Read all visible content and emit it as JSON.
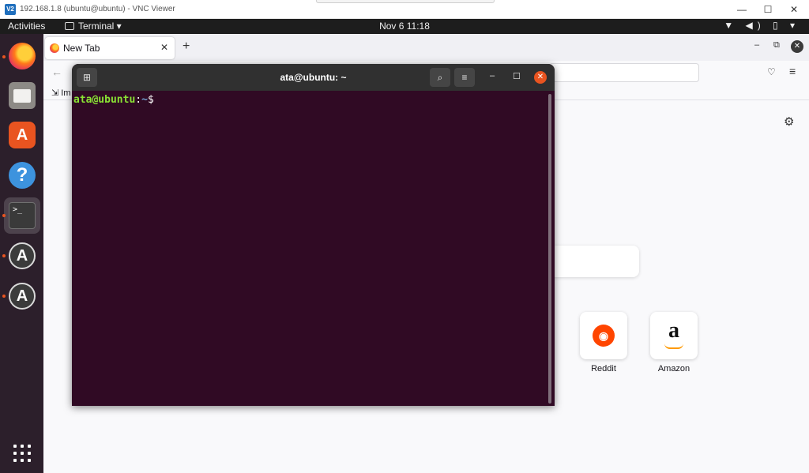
{
  "vnc": {
    "logo": "V2",
    "title": "192.168.1.8 (ubuntu@ubuntu) - VNC Viewer",
    "minimize": "—",
    "maximize": "☐",
    "close": "✕"
  },
  "topbar": {
    "activities": "Activities",
    "app_menu": "Terminal ▾",
    "clock": "Nov 6  11:18",
    "status_icons": "▼ ◀) ▯ ▾"
  },
  "dock": {
    "items": [
      {
        "name": "Firefox",
        "icon": "firefox-icon",
        "running": true
      },
      {
        "name": "Files",
        "icon": "files-icon",
        "running": false
      },
      {
        "name": "Ubuntu Software",
        "icon": "store-icon",
        "glyph": "A",
        "running": false
      },
      {
        "name": "Help",
        "icon": "help-icon",
        "glyph": "?",
        "running": false
      },
      {
        "name": "Terminal",
        "icon": "terminal-icon",
        "glyph": ">_",
        "running": true
      },
      {
        "name": "Software Updater",
        "icon": "updater-icon",
        "glyph": "A",
        "running": true
      },
      {
        "name": "Software Updater",
        "icon": "updater-icon",
        "glyph": "A",
        "running": true
      }
    ]
  },
  "firefox": {
    "tab_label": "New Tab",
    "tab_close": "✕",
    "new_tab": "+",
    "win_minimize": "–",
    "win_restore": "⧉",
    "win_close": "✕",
    "back": "←",
    "pocket": "♡",
    "menu": "≡",
    "bookmark_item": "⇲ Im",
    "settings": "⚙",
    "shortcuts": [
      {
        "label": "Reddit",
        "glyph": "◉"
      },
      {
        "label": "Amazon",
        "glyph": "a"
      }
    ]
  },
  "terminal": {
    "title": "ata@ubuntu: ~",
    "new_tab_glyph": "⊞",
    "search_glyph": "⌕",
    "menu_glyph": "≡",
    "minimize": "–",
    "maximize": "☐",
    "close": "✕",
    "prompt_user": "ata@ubuntu",
    "prompt_sep": ":",
    "prompt_path": "~",
    "prompt_symbol": "$"
  }
}
